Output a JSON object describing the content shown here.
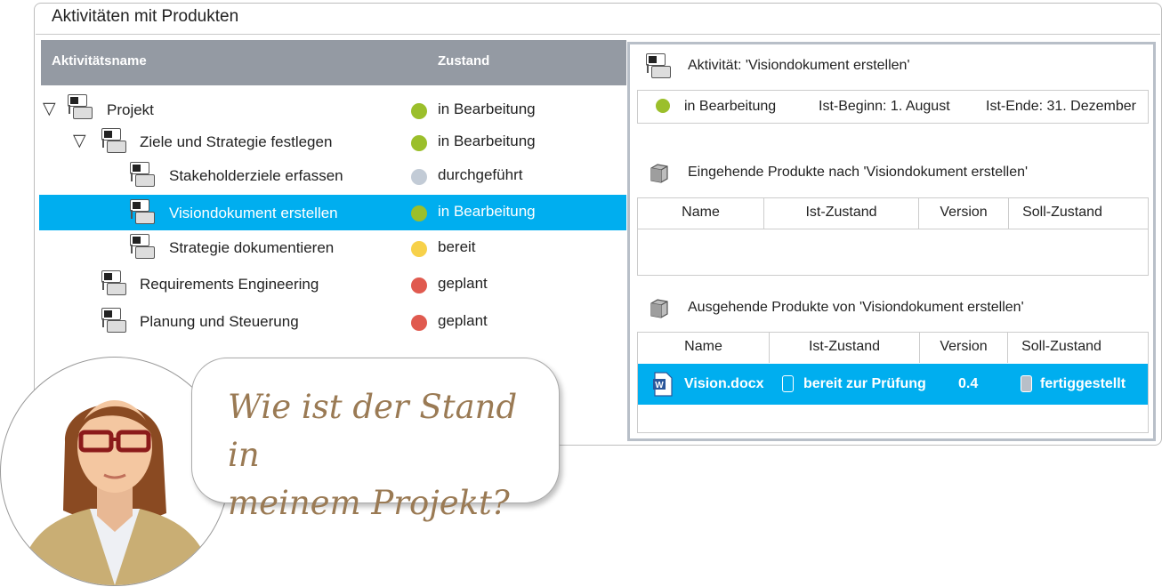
{
  "window": {
    "title": "Aktivitäten mit Produkten"
  },
  "tree": {
    "columns": {
      "name": "Aktivitätsname",
      "state": "Zustand"
    },
    "rows": [
      {
        "label": "Projekt",
        "state": "in Bearbeitung",
        "color": "#9bbf2b",
        "expanded": true
      },
      {
        "label": "Ziele und Strategie festlegen",
        "state": "in Bearbeitung",
        "color": "#9bbf2b",
        "expanded": true
      },
      {
        "label": "Stakeholderziele erfassen",
        "state": "durchgeführt",
        "color": "#c2cbd6"
      },
      {
        "label": "Visiondokument erstellen",
        "state": "in Bearbeitung",
        "color": "#9bbf2b",
        "selected": true
      },
      {
        "label": "Strategie dokumentieren",
        "state": "bereit",
        "color": "#f7d14a"
      },
      {
        "label": "Requirements Engineering",
        "state": "geplant",
        "color": "#e05a4f"
      },
      {
        "label": "Planung und Steuerung",
        "state": "geplant",
        "color": "#e05a4f"
      }
    ]
  },
  "detail": {
    "activity_title": "Aktivität: 'Visiondokument erstellen'",
    "status": {
      "state": "in Bearbeitung",
      "color": "#9bbf2b",
      "start": "Ist-Beginn: 1. August",
      "end": "Ist-Ende: 31. Dezember"
    },
    "incoming": {
      "title": "Eingehende Produkte nach 'Visiondokument erstellen'",
      "columns": [
        "Name",
        "Ist-Zustand",
        "Version",
        "Soll-Zustand"
      ],
      "rows": []
    },
    "outgoing": {
      "title": "Ausgehende Produkte von 'Visiondokument erstellen'",
      "columns": [
        "Name",
        "Ist-Zustand",
        "Version",
        "Soll-Zustand"
      ],
      "rows": [
        {
          "name": "Vision.docx",
          "ist": "bereit zur Prüfung",
          "version": "0.4",
          "soll": "fertiggestellt"
        }
      ]
    }
  },
  "bubble": {
    "line1": "Wie ist der Stand in",
    "line2": "meinem Projekt?"
  }
}
